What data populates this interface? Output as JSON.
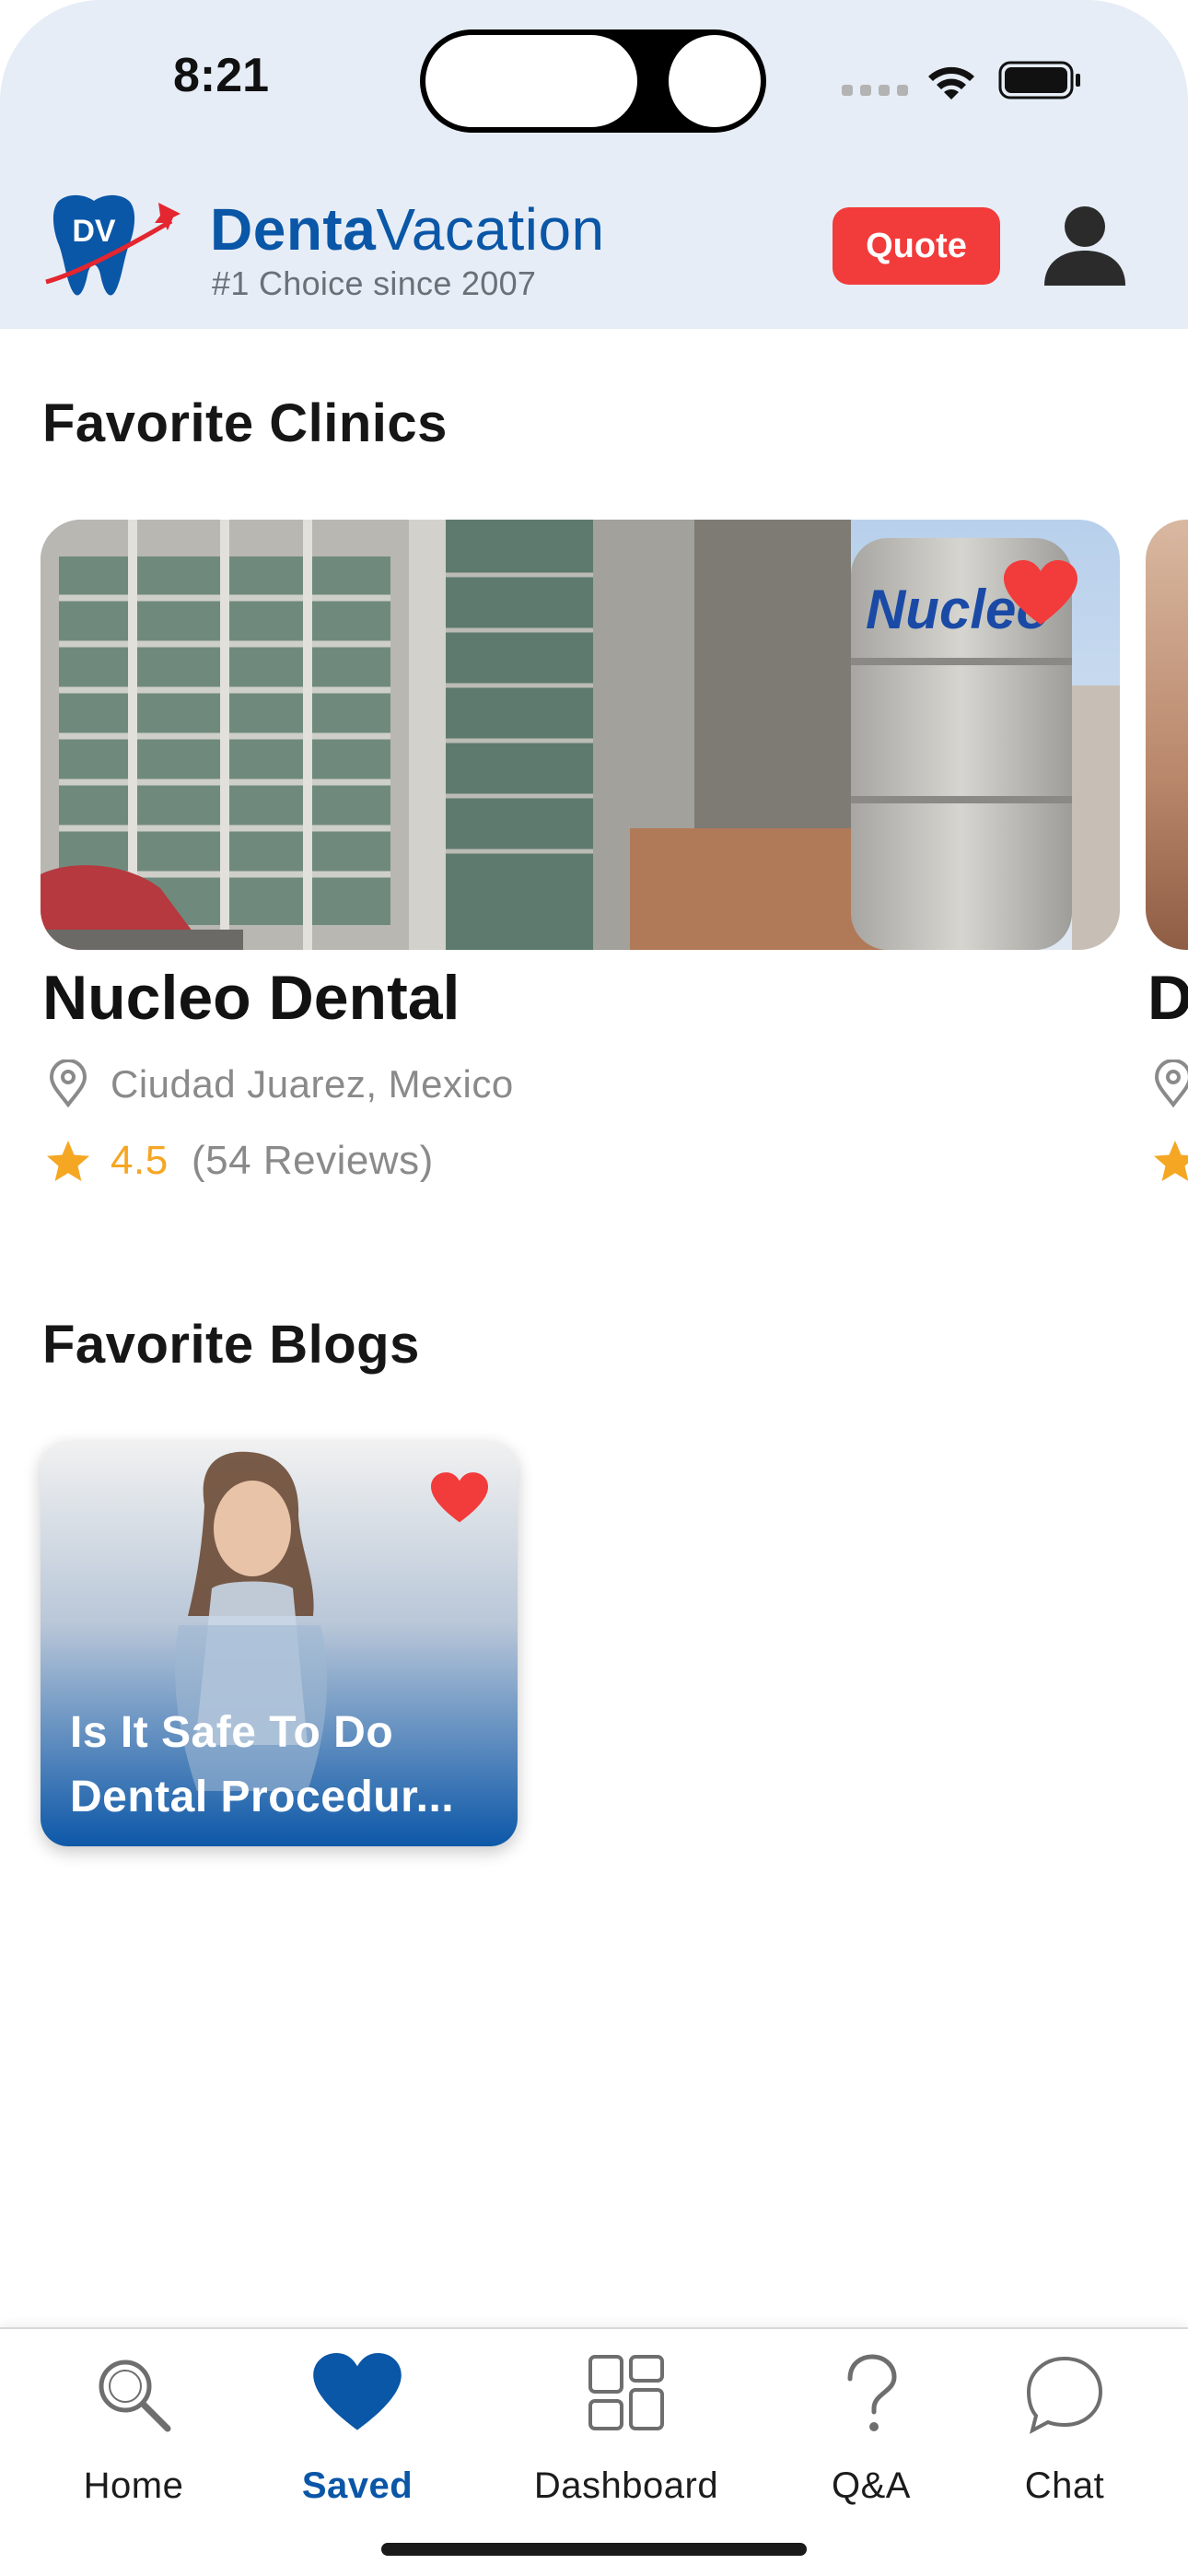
{
  "status_bar": {
    "time": "8:21"
  },
  "header": {
    "logo_monogram": "DV",
    "brand_part1": "Denta",
    "brand_part2": "Vacation",
    "tagline": "#1 Choice since 2007",
    "quote_label": "Quote"
  },
  "colors": {
    "brand_blue": "#0a56a7",
    "accent_red": "#f23b3b",
    "star_yellow": "#f5a623",
    "header_bg": "#e6edf6"
  },
  "favorite_clinics": {
    "title": "Favorite Clinics",
    "items": [
      {
        "name": "Nucleo Dental",
        "location": "Ciudad Juarez, Mexico",
        "rating": "4.5",
        "reviews": "(54 Reviews)",
        "favorited": true,
        "sign_text": "Nucleo"
      },
      {
        "name": "D",
        "favorited": true
      }
    ]
  },
  "favorite_blogs": {
    "title": "Favorite Blogs",
    "items": [
      {
        "title": "Is It Safe To Do Dental Procedur...",
        "favorited": true
      }
    ]
  },
  "tabbar": {
    "items": [
      {
        "label": "Home",
        "icon": "search-icon",
        "active": false
      },
      {
        "label": "Saved",
        "icon": "heart-icon",
        "active": true
      },
      {
        "label": "Dashboard",
        "icon": "dashboard-grid-icon",
        "active": false
      },
      {
        "label": "Q&A",
        "icon": "question-icon",
        "active": false
      },
      {
        "label": "Chat",
        "icon": "chat-bubble-icon",
        "active": false
      }
    ]
  }
}
